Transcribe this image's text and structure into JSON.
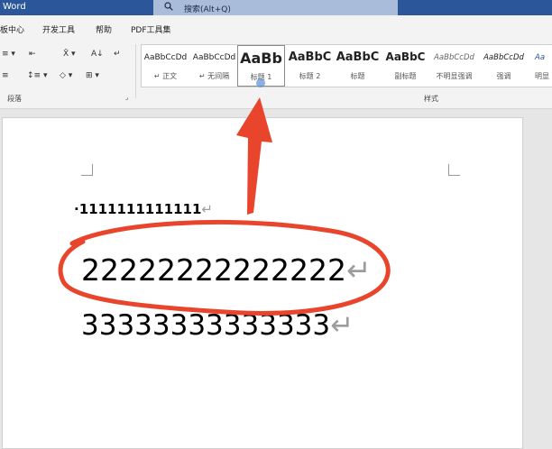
{
  "window": {
    "title": "Word"
  },
  "search": {
    "label": "搜索(Alt+Q)"
  },
  "menu": {
    "items": [
      "板中心",
      "开发工具",
      "帮助",
      "PDF工具集"
    ]
  },
  "ribbon": {
    "groups": {
      "paragraph": "段落",
      "styles": "样式"
    },
    "left_buttons": [
      "≡ ▾",
      "⇤",
      "A↓",
      "↵",
      "≡",
      "↕≡ ▾",
      "◇ ▾",
      "⊞ ▾"
    ],
    "styles": [
      {
        "preview": "AaBbCcDd",
        "name": "↵ 正文"
      },
      {
        "preview": "AaBbCcDd",
        "name": "↵ 无间隔"
      },
      {
        "preview": "AaBb",
        "name": "标题 1"
      },
      {
        "preview": "AaBbC",
        "name": "标题 2"
      },
      {
        "preview": "AaBbC",
        "name": "标题"
      },
      {
        "preview": "AaBbC",
        "name": "副标题"
      },
      {
        "preview": "AaBbCcDd",
        "name": "不明显强调"
      },
      {
        "preview": "AaBbCcDd",
        "name": "强调"
      },
      {
        "preview": "Aa",
        "name": "明显"
      }
    ]
  },
  "document": {
    "lines": [
      "·1111111111111",
      "22222222222222",
      "33333333333333"
    ],
    "paragraph_mark": "↵"
  },
  "colors": {
    "titlebar": "#2b579a",
    "annotation": "#e8452c"
  }
}
